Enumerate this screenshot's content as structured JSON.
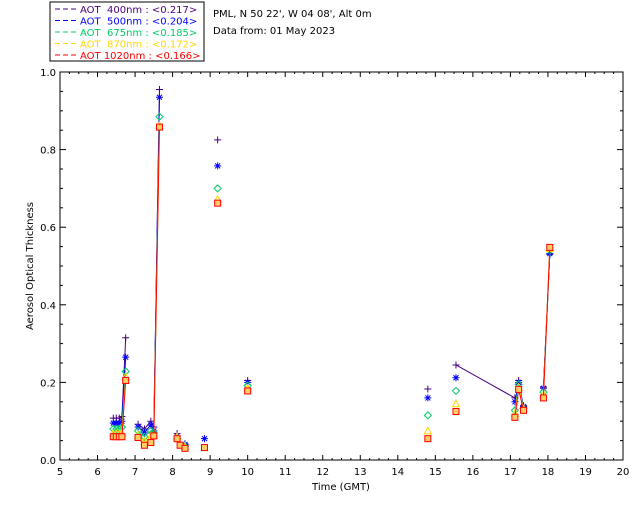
{
  "chart_data": {
    "type": "scatter",
    "info": {
      "station": "PML, N 50 22', W 04 08', Alt 0m",
      "date_line": "Data from: 01 May 2023"
    },
    "xlabel": "Time (GMT)",
    "ylabel": "Aerosol Optical Thickness",
    "xlim": [
      5,
      20
    ],
    "ylim": [
      0,
      1.0
    ],
    "x_ticks": [
      "5",
      "6",
      "7",
      "8",
      "9",
      "10",
      "11",
      "12",
      "13",
      "14",
      "15",
      "16",
      "17",
      "18",
      "19",
      "20"
    ],
    "y_ticks": [
      "0.0",
      "0.2",
      "0.4",
      "0.6",
      "0.8",
      "1.0"
    ],
    "grid": false,
    "legend_position": "top-left, outside plot",
    "series": [
      {
        "name": "AOT  400nm : <0.217>",
        "color": "#4b0082",
        "marker": "plus",
        "points": [
          [
            6.42,
            0.108
          ],
          [
            6.5,
            0.108
          ],
          [
            6.58,
            0.108
          ],
          [
            6.65,
            0.112
          ],
          [
            6.75,
            0.315
          ],
          [
            7.08,
            0.092
          ],
          [
            7.25,
            0.08
          ],
          [
            7.42,
            0.1
          ],
          [
            7.5,
            0.085
          ],
          [
            7.65,
            0.955
          ],
          [
            8.12,
            0.068
          ],
          [
            8.33,
            0.042
          ],
          [
            9.2,
            0.825
          ],
          [
            10.0,
            0.205
          ],
          [
            14.8,
            0.183
          ],
          [
            15.55,
            0.245
          ],
          [
            17.12,
            0.16
          ],
          [
            17.22,
            0.205
          ],
          [
            17.35,
            0.14
          ],
          [
            17.88,
            0.188
          ],
          [
            18.05,
            0.53
          ]
        ],
        "connected_segments": [
          [
            0,
            4
          ],
          [
            5,
            9
          ],
          [
            15,
            16
          ],
          [
            19,
            20
          ]
        ]
      },
      {
        "name": "AOT  500nm : <0.204>",
        "color": "#0000ff",
        "marker": "asterisk",
        "points": [
          [
            6.42,
            0.095
          ],
          [
            6.5,
            0.095
          ],
          [
            6.58,
            0.095
          ],
          [
            6.65,
            0.1
          ],
          [
            6.75,
            0.265
          ],
          [
            7.08,
            0.085
          ],
          [
            7.25,
            0.072
          ],
          [
            7.42,
            0.09
          ],
          [
            7.5,
            0.075
          ],
          [
            7.65,
            0.935
          ],
          [
            8.12,
            0.062
          ],
          [
            8.33,
            0.04
          ],
          [
            8.85,
            0.055
          ],
          [
            9.2,
            0.758
          ],
          [
            10.0,
            0.2
          ],
          [
            14.8,
            0.16
          ],
          [
            15.55,
            0.212
          ],
          [
            17.12,
            0.15
          ],
          [
            17.22,
            0.2
          ],
          [
            17.35,
            0.138
          ],
          [
            17.88,
            0.185
          ],
          [
            18.05,
            0.532
          ]
        ],
        "connected_segments": [
          [
            0,
            4
          ],
          [
            5,
            9
          ],
          [
            17,
            19
          ],
          [
            20,
            21
          ]
        ]
      },
      {
        "name": "AOT  675nm : <0.185>",
        "color": "#00cc66",
        "marker": "diamond",
        "points": [
          [
            6.42,
            0.08
          ],
          [
            6.5,
            0.08
          ],
          [
            6.58,
            0.08
          ],
          [
            6.65,
            0.085
          ],
          [
            6.75,
            0.228
          ],
          [
            7.08,
            0.075
          ],
          [
            7.25,
            0.06
          ],
          [
            7.42,
            0.075
          ],
          [
            7.5,
            0.07
          ],
          [
            7.65,
            0.885
          ],
          [
            8.12,
            0.055
          ],
          [
            8.33,
            0.035
          ],
          [
            9.2,
            0.7
          ],
          [
            10.0,
            0.192
          ],
          [
            14.8,
            0.115
          ],
          [
            15.55,
            0.178
          ],
          [
            17.12,
            0.128
          ],
          [
            17.22,
            0.195
          ],
          [
            17.35,
            0.132
          ],
          [
            17.88,
            0.175
          ],
          [
            18.05,
            0.54
          ]
        ],
        "connected_segments": [
          [
            0,
            4
          ],
          [
            5,
            9
          ],
          [
            16,
            18
          ],
          [
            19,
            20
          ]
        ]
      },
      {
        "name": "AOT  870nm : <0.172>",
        "color": "#ffd700",
        "marker": "triangle",
        "points": [
          [
            6.42,
            0.068
          ],
          [
            6.5,
            0.068
          ],
          [
            6.58,
            0.068
          ],
          [
            6.65,
            0.07
          ],
          [
            6.75,
            0.215
          ],
          [
            7.08,
            0.065
          ],
          [
            7.25,
            0.048
          ],
          [
            7.42,
            0.062
          ],
          [
            7.5,
            0.065
          ],
          [
            7.65,
            0.862
          ],
          [
            8.12,
            0.06
          ],
          [
            8.33,
            0.034
          ],
          [
            9.2,
            0.672
          ],
          [
            10.0,
            0.185
          ],
          [
            14.8,
            0.075
          ],
          [
            15.55,
            0.145
          ],
          [
            17.12,
            0.12
          ],
          [
            17.22,
            0.188
          ],
          [
            17.35,
            0.132
          ],
          [
            17.88,
            0.168
          ],
          [
            18.05,
            0.545
          ]
        ],
        "connected_segments": [
          [
            0,
            4
          ],
          [
            5,
            9
          ],
          [
            16,
            18
          ],
          [
            19,
            20
          ]
        ]
      },
      {
        "name": "AOT 1020nm : <0.166>",
        "color": "#ff0000",
        "marker": "square",
        "points": [
          [
            6.42,
            0.06
          ],
          [
            6.5,
            0.06
          ],
          [
            6.58,
            0.06
          ],
          [
            6.65,
            0.06
          ],
          [
            6.75,
            0.205
          ],
          [
            7.08,
            0.058
          ],
          [
            7.25,
            0.038
          ],
          [
            7.42,
            0.045
          ],
          [
            7.5,
            0.062
          ],
          [
            7.65,
            0.858
          ],
          [
            8.12,
            0.055
          ],
          [
            8.2,
            0.038
          ],
          [
            8.33,
            0.03
          ],
          [
            8.85,
            0.032
          ],
          [
            9.2,
            0.662
          ],
          [
            10.0,
            0.178
          ],
          [
            14.8,
            0.055
          ],
          [
            15.55,
            0.125
          ],
          [
            17.12,
            0.11
          ],
          [
            17.22,
            0.182
          ],
          [
            17.35,
            0.128
          ],
          [
            17.88,
            0.16
          ],
          [
            18.05,
            0.548
          ]
        ],
        "connected_segments": [
          [
            0,
            4
          ],
          [
            5,
            9
          ],
          [
            18,
            20
          ],
          [
            21,
            22
          ]
        ]
      }
    ]
  }
}
